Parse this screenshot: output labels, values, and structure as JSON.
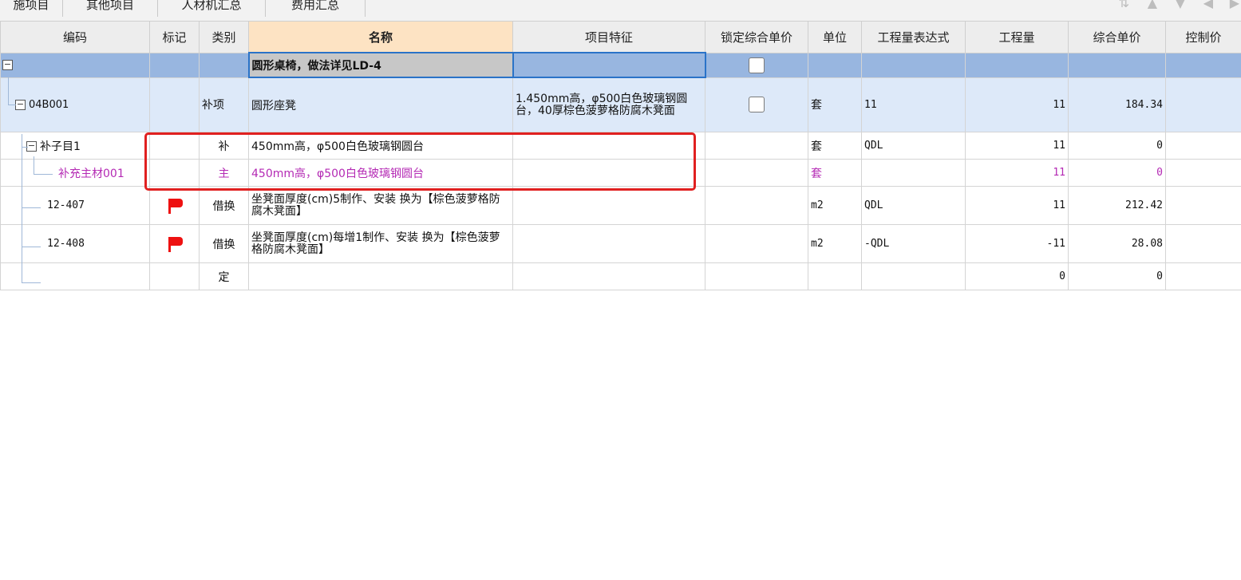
{
  "tabs": [
    "施项目",
    "其他项目",
    "人材机汇总",
    "费用汇总"
  ],
  "toolbar_icons": [
    "sort-icon",
    "move-up-icon",
    "move-down-icon",
    "move-left-icon",
    "move-right-icon"
  ],
  "columns": [
    "编码",
    "标记",
    "类别",
    "名称",
    "项目特征",
    "锁定综合单价",
    "单位",
    "工程量表达式",
    "工程量",
    "综合单价",
    "控制价"
  ],
  "rows": [
    {
      "code": "",
      "mark": "",
      "type": "",
      "name": "圆形桌椅，做法详见LD-4",
      "feature": "",
      "locked": true,
      "unit": "",
      "expr": "",
      "qty": "",
      "price": "",
      "control": ""
    },
    {
      "code": "04B001",
      "mark": "",
      "type": "补项",
      "name": "圆形座凳",
      "feature": "1.450mm高，φ500白色玻璃钢圆台，40厚棕色菠萝格防腐木凳面",
      "locked": true,
      "unit": "套",
      "expr": "11",
      "qty": "11",
      "price": "184.34",
      "control": ""
    },
    {
      "code": "补子目1",
      "mark": "",
      "type": "补",
      "name": "450mm高，φ500白色玻璃钢圆台",
      "feature": "",
      "locked": false,
      "unit": "套",
      "expr": "QDL",
      "qty": "11",
      "price": "0",
      "control": ""
    },
    {
      "code": "补充主材001",
      "mark": "",
      "type": "主",
      "name": "450mm高，φ500白色玻璃钢圆台",
      "feature": "",
      "locked": false,
      "unit": "套",
      "expr": "",
      "qty": "11",
      "price": "0",
      "control": ""
    },
    {
      "code": "12-407",
      "mark": "flag",
      "type": "借换",
      "name": "坐凳面厚度(cm)5制作、安装  换为【棕色菠萝格防腐木凳面】",
      "feature": "",
      "locked": false,
      "unit": "m2",
      "expr": "QDL",
      "qty": "11",
      "price": "212.42",
      "control": ""
    },
    {
      "code": "12-408",
      "mark": "flag",
      "type": "借换",
      "name": "坐凳面厚度(cm)每增1制作、安装  换为【棕色菠萝格防腐木凳面】",
      "feature": "",
      "locked": false,
      "unit": "m2",
      "expr": "-QDL",
      "qty": "-11",
      "price": "28.08",
      "control": ""
    },
    {
      "code": "",
      "mark": "",
      "type": "定",
      "name": "",
      "feature": "",
      "locked": false,
      "unit": "",
      "expr": "",
      "qty": "0",
      "price": "0",
      "control": ""
    }
  ],
  "colors": {
    "selected_row": "#98b6e0",
    "child_row": "#dde9f9",
    "main_material_text": "#b42ab4",
    "highlight_box": "#e02020",
    "name_header": "#fde3c3"
  }
}
